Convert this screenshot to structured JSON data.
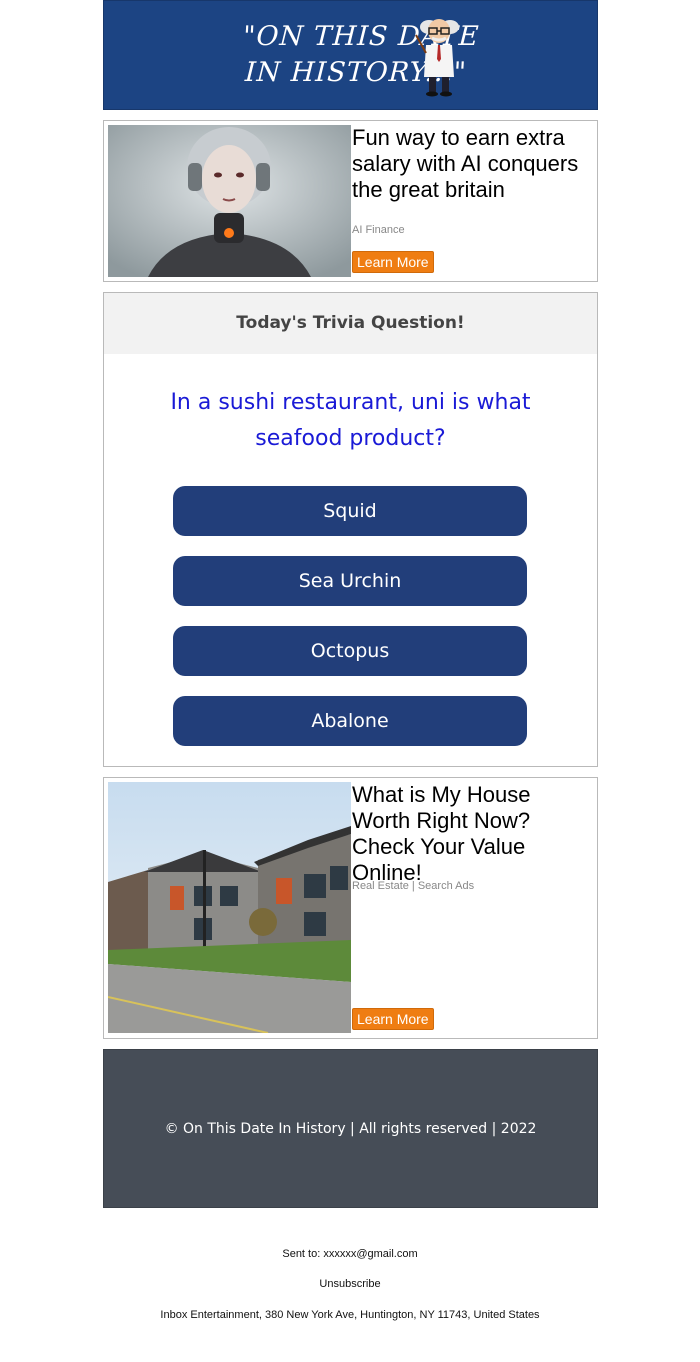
{
  "header": {
    "logo_line1": "\"ON THIS DATE",
    "logo_line2": "IN HISTORY...\""
  },
  "ads": [
    {
      "title": "Fun way to earn extra salary with AI conquers the great britain",
      "source": "AI Finance",
      "button": "Learn More"
    },
    {
      "title": "What is My House Worth Right Now? Check Your Value Online!",
      "source": "Real Estate | Search Ads",
      "button": "Learn More"
    }
  ],
  "trivia": {
    "heading": "Today's Trivia Question!",
    "question": "In a sushi restaurant, uni is what seafood product?",
    "answers": [
      "Squid",
      "Sea Urchin",
      "Octopus",
      "Abalone"
    ]
  },
  "footer": {
    "copyright": "© On This Date In History | All rights reserved | 2022"
  },
  "email_footer": {
    "sent_to": "Sent to: xxxxxx@gmail.com",
    "unsubscribe": "Unsubscribe",
    "address": "Inbox Entertainment, 380 New York Ave, Huntington, NY 11743, United States"
  },
  "colors": {
    "header_bg": "#1c4483",
    "answer_bg": "#223e7a",
    "question_text": "#1a1ad6",
    "cta_orange": "#ef7d12",
    "footer_bg": "#464d57"
  }
}
